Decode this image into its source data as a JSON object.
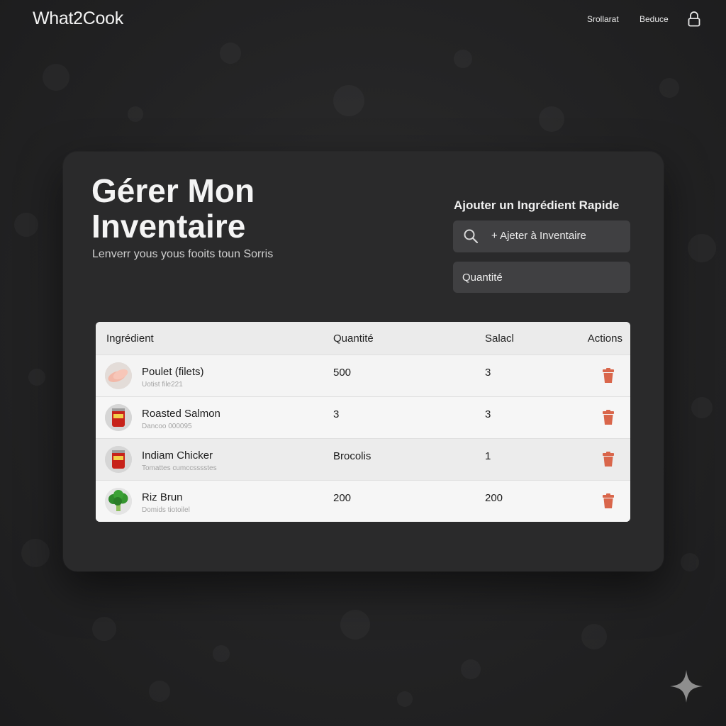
{
  "header": {
    "logo": "What2Cook",
    "nav": [
      "Srollarat",
      "Beduce"
    ],
    "account_icon": "lock-icon"
  },
  "main": {
    "title": "Gérer Mon Inventaire",
    "subtitle": "Lenverr yous yous fooits toun Sorris"
  },
  "quick_add": {
    "label": "Ajouter un Ingrédient Rapide",
    "button_label": "+ Ajeter à Inventaire",
    "search_icon": "search-icon",
    "quantity_placeholder": "Quantité"
  },
  "table": {
    "headers": [
      "Ingrédient",
      "Quantité",
      "Salacl",
      "Actions"
    ],
    "rows": [
      {
        "name": "Poulet (filets)",
        "sub": "Uotist file221",
        "quantity": "500",
        "third": "3",
        "thumb": "chicken-thumbnail"
      },
      {
        "name": "Roasted Salmon",
        "sub": "Dancoo 000095",
        "quantity": "3",
        "third": "3",
        "thumb": "tomato-can-thumbnail"
      },
      {
        "name": "Indiam Chicker",
        "sub": "Tomattes cumccsssstes",
        "quantity": "Brocolis",
        "third": "1",
        "thumb": "tomato-can-thumbnail"
      },
      {
        "name": "Riz Brun",
        "sub": "Domids tiotoilel",
        "quantity": "200",
        "third": "200",
        "thumb": "broccoli-thumbnail"
      }
    ],
    "action_icon": "trash-icon"
  },
  "colors": {
    "background": "#232324",
    "panel": "#2a2a2b",
    "input": "#404042",
    "table": "#f4f4f4",
    "delete": "#d9664b"
  }
}
